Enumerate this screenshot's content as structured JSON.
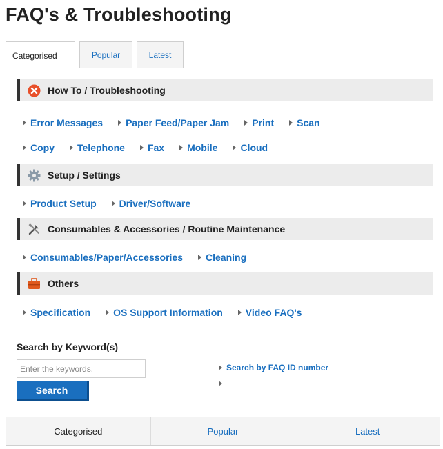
{
  "page": {
    "title": "FAQ's & Troubleshooting"
  },
  "tabs": [
    {
      "label": "Categorised",
      "active": true
    },
    {
      "label": "Popular",
      "active": false
    },
    {
      "label": "Latest",
      "active": false
    }
  ],
  "sections": [
    {
      "title": "How To / Troubleshooting",
      "icon": "error-circle-icon",
      "rows": [
        [
          "Error Messages",
          "Paper Feed/Paper Jam",
          "Print",
          "Scan"
        ],
        [
          "Copy",
          "Telephone",
          "Fax",
          "Mobile",
          "Cloud"
        ]
      ]
    },
    {
      "title": "Setup / Settings",
      "icon": "gear-icon",
      "rows": [
        [
          "Product Setup",
          "Driver/Software"
        ]
      ]
    },
    {
      "title": "Consumables & Accessories / Routine Maintenance",
      "icon": "tools-icon",
      "rows": [
        [
          "Consumables/Paper/Accessories",
          "Cleaning"
        ]
      ]
    },
    {
      "title": "Others",
      "icon": "toolbox-icon",
      "rows": [
        [
          "Specification",
          "OS Support Information",
          "Video FAQ's"
        ]
      ]
    }
  ],
  "search": {
    "title": "Search by Keyword(s)",
    "placeholder": "Enter the keywords.",
    "button_label": "Search",
    "side_links": [
      "Search by FAQ ID number",
      ""
    ]
  },
  "bottom_tabs": [
    {
      "label": "Categorised",
      "active": true
    },
    {
      "label": "Popular",
      "active": false
    },
    {
      "label": "Latest",
      "active": false
    }
  ],
  "colors": {
    "link": "#1a6fbf",
    "header_bg": "#ececec",
    "error_icon": "#e8502a",
    "toolbox_icon": "#e05a1e",
    "gear_icon": "#8a9aa8"
  }
}
